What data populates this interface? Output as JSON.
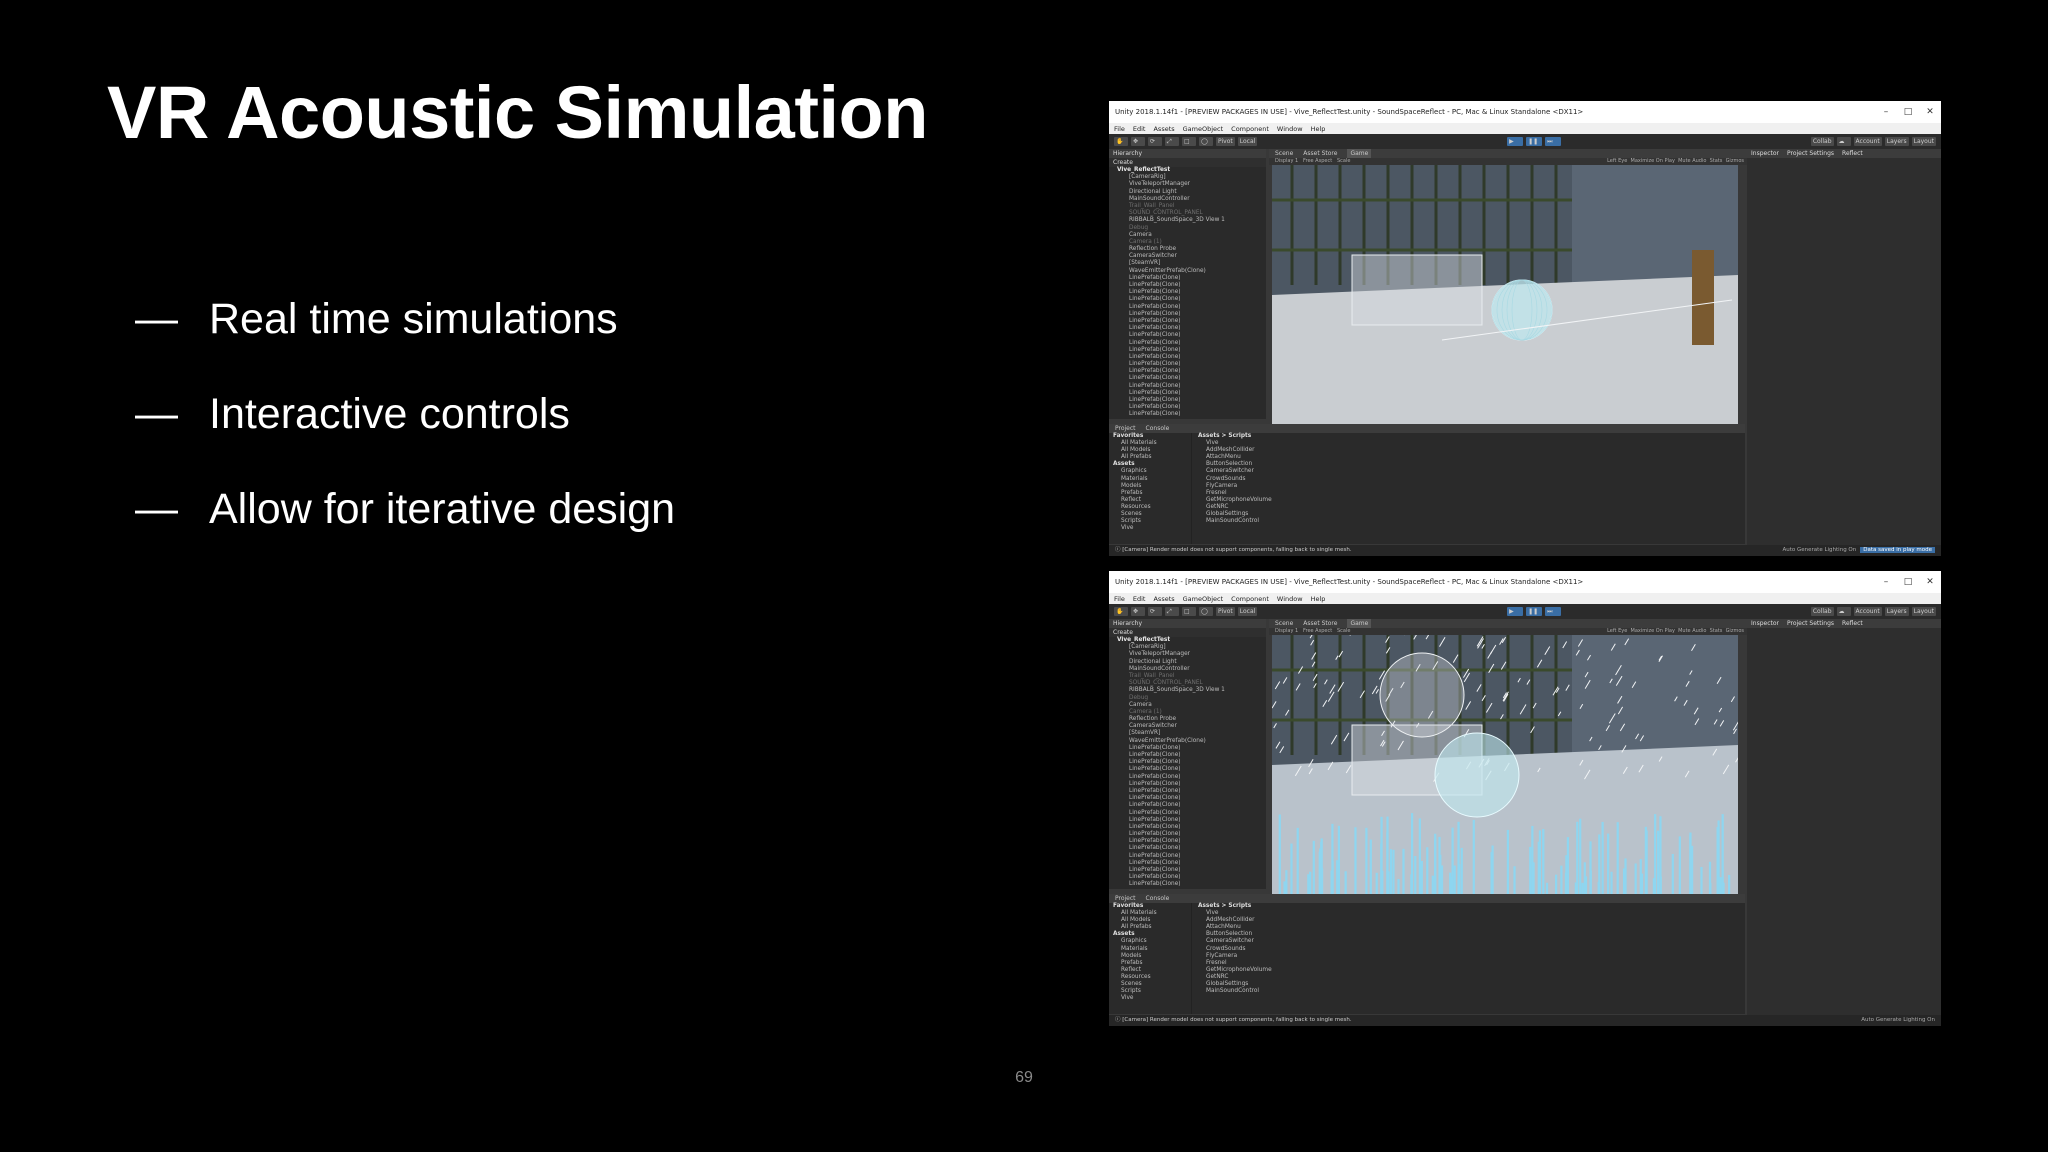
{
  "slide": {
    "title": "VR Acoustic Simulation",
    "bullets": [
      "Real time simulations",
      "Interactive controls",
      "Allow for iterative design"
    ],
    "dash": "—",
    "page_number": "69"
  },
  "unity": {
    "window_title": "Unity 2018.1.14f1 - [PREVIEW PACKAGES IN USE] - Vive_ReflectTest.unity - SoundSpaceReflect - PC, Mac & Linux Standalone <DX11>",
    "menu": [
      "File",
      "Edit",
      "Assets",
      "GameObject",
      "Component",
      "Window",
      "Help"
    ],
    "toolbar": {
      "pivot": "Pivot",
      "local": "Local",
      "collab": "Collab",
      "account": "Account",
      "layers": "Layers",
      "layout": "Layout"
    },
    "hierarchy_tab": "Hierarchy",
    "hierarchy_create": "Create",
    "hierarchy_items": [
      "Vive_ReflectTest",
      "[CameraRig]",
      "ViveTeleportManager",
      "Directional Light",
      "MainSoundController",
      "Trail_Wall_Panel",
      "SOUND_CONTROL_PANEL",
      "RIBBALB_SoundSpace_3D View 1",
      "Debug",
      "Camera",
      "Camera (1)",
      "Reflection Probe",
      "CameraSwitcher",
      "[SteamVR]",
      "WaveEmitterPrefab(Clone)",
      "LinePrefab(Clone)",
      "LinePrefab(Clone)",
      "LinePrefab(Clone)",
      "LinePrefab(Clone)",
      "LinePrefab(Clone)",
      "LinePrefab(Clone)",
      "LinePrefab(Clone)",
      "LinePrefab(Clone)",
      "LinePrefab(Clone)",
      "LinePrefab(Clone)",
      "LinePrefab(Clone)",
      "LinePrefab(Clone)",
      "LinePrefab(Clone)",
      "LinePrefab(Clone)",
      "LinePrefab(Clone)",
      "LinePrefab(Clone)",
      "LinePrefab(Clone)",
      "LinePrefab(Clone)",
      "LinePrefab(Clone)",
      "LinePrefab(Clone)",
      "LinePrefab(Clone)",
      "LinePrefab(Clone)"
    ],
    "scene_tabs": [
      "Scene",
      "Asset Store",
      "Game"
    ],
    "game_bar": {
      "display": "Display 1",
      "aspect": "Free Aspect",
      "scale": "Scale",
      "eye": "Left Eye",
      "maximize": "Maximize On Play",
      "mute": "Mute Audio",
      "stats": "Stats",
      "gizmos": "Gizmos"
    },
    "inspector_tabs": [
      "Inspector",
      "Project Settings",
      "Reflect"
    ],
    "project_tabs": [
      "Project",
      "Console"
    ],
    "project_create": "Create",
    "favorites": [
      "Favorites",
      "All Materials",
      "All Models",
      "All Prefabs"
    ],
    "assets_tree": [
      "Assets",
      "Graphics",
      "Materials",
      "Models",
      "Prefabs",
      "Reflect",
      "Resources",
      "Scenes",
      "Scripts",
      "Vive"
    ],
    "breadcrumb": "Assets > Scripts",
    "scripts": [
      "Vive",
      "AddMeshCollider",
      "AttachMenu",
      "ButtonSelection",
      "CameraSwitcher",
      "CrowdSounds",
      "FlyCamera",
      "Fresnel",
      "GetMicrophoneVolume",
      "GetNRC",
      "GlobalSettings",
      "MainSoundControl"
    ],
    "status_message": "[Camera] Render model does not support components, falling back to single mesh.",
    "status_right": "Auto Generate Lighting On",
    "status_badge": "Data saved in play mode"
  }
}
